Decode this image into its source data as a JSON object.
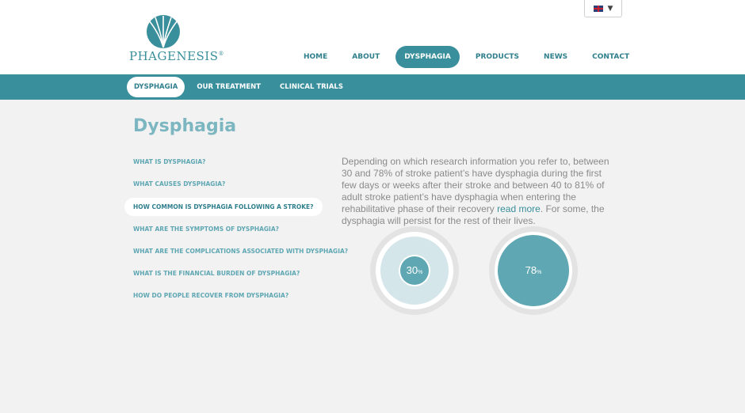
{
  "brand": {
    "name": "PHAGENESIS",
    "registered": "®",
    "accent": "#3a8f9c",
    "accent_light": "#7cb6c0"
  },
  "language": {
    "flag_icon": "uk-flag-icon",
    "chevron_icon": "chevron-down-icon"
  },
  "main_nav": [
    {
      "label": "HOME"
    },
    {
      "label": "ABOUT"
    },
    {
      "label": "DYSPHAGIA",
      "active": true
    },
    {
      "label": "PRODUCTS"
    },
    {
      "label": "NEWS"
    },
    {
      "label": "CONTACT"
    }
  ],
  "sub_nav": [
    {
      "label": "DYSPHAGIA",
      "active": true
    },
    {
      "label": "OUR TREATMENT"
    },
    {
      "label": "CLINICAL TRIALS"
    }
  ],
  "page_title": "Dysphagia",
  "side_menu": [
    {
      "label": "WHAT IS DYSPHAGIA?"
    },
    {
      "label": "WHAT CAUSES DYSPHAGIA?"
    },
    {
      "label": "HOW COMMON IS DYSPHAGIA FOLLOWING A STROKE?",
      "active": true
    },
    {
      "label": "WHAT ARE THE SYMPTOMS OF DYSPHAGIA?"
    },
    {
      "label": "WHAT ARE THE COMPLICATIONS ASSOCIATED WITH DYSPHAGIA?"
    },
    {
      "label": "WHAT IS THE FINANCIAL BURDEN OF DYSPHAGIA?"
    },
    {
      "label": "HOW DO PEOPLE RECOVER FROM DYSPHAGIA?"
    }
  ],
  "content": {
    "paragraph_before": "Depending on which research information you refer to, between 30 and 78% of stroke patient’s have dysphagia during the first few days or weeks after their stroke and between 40 to 81% of adult stroke patient’s have dysphagia when entering the rehabilitative phase of their recovery ",
    "link": "read more",
    "paragraph_after": ". For some, the dysphagia will persist for the rest of their lives."
  },
  "stats": [
    {
      "value": "30",
      "unit": "%"
    },
    {
      "value": "78",
      "unit": "%"
    }
  ]
}
